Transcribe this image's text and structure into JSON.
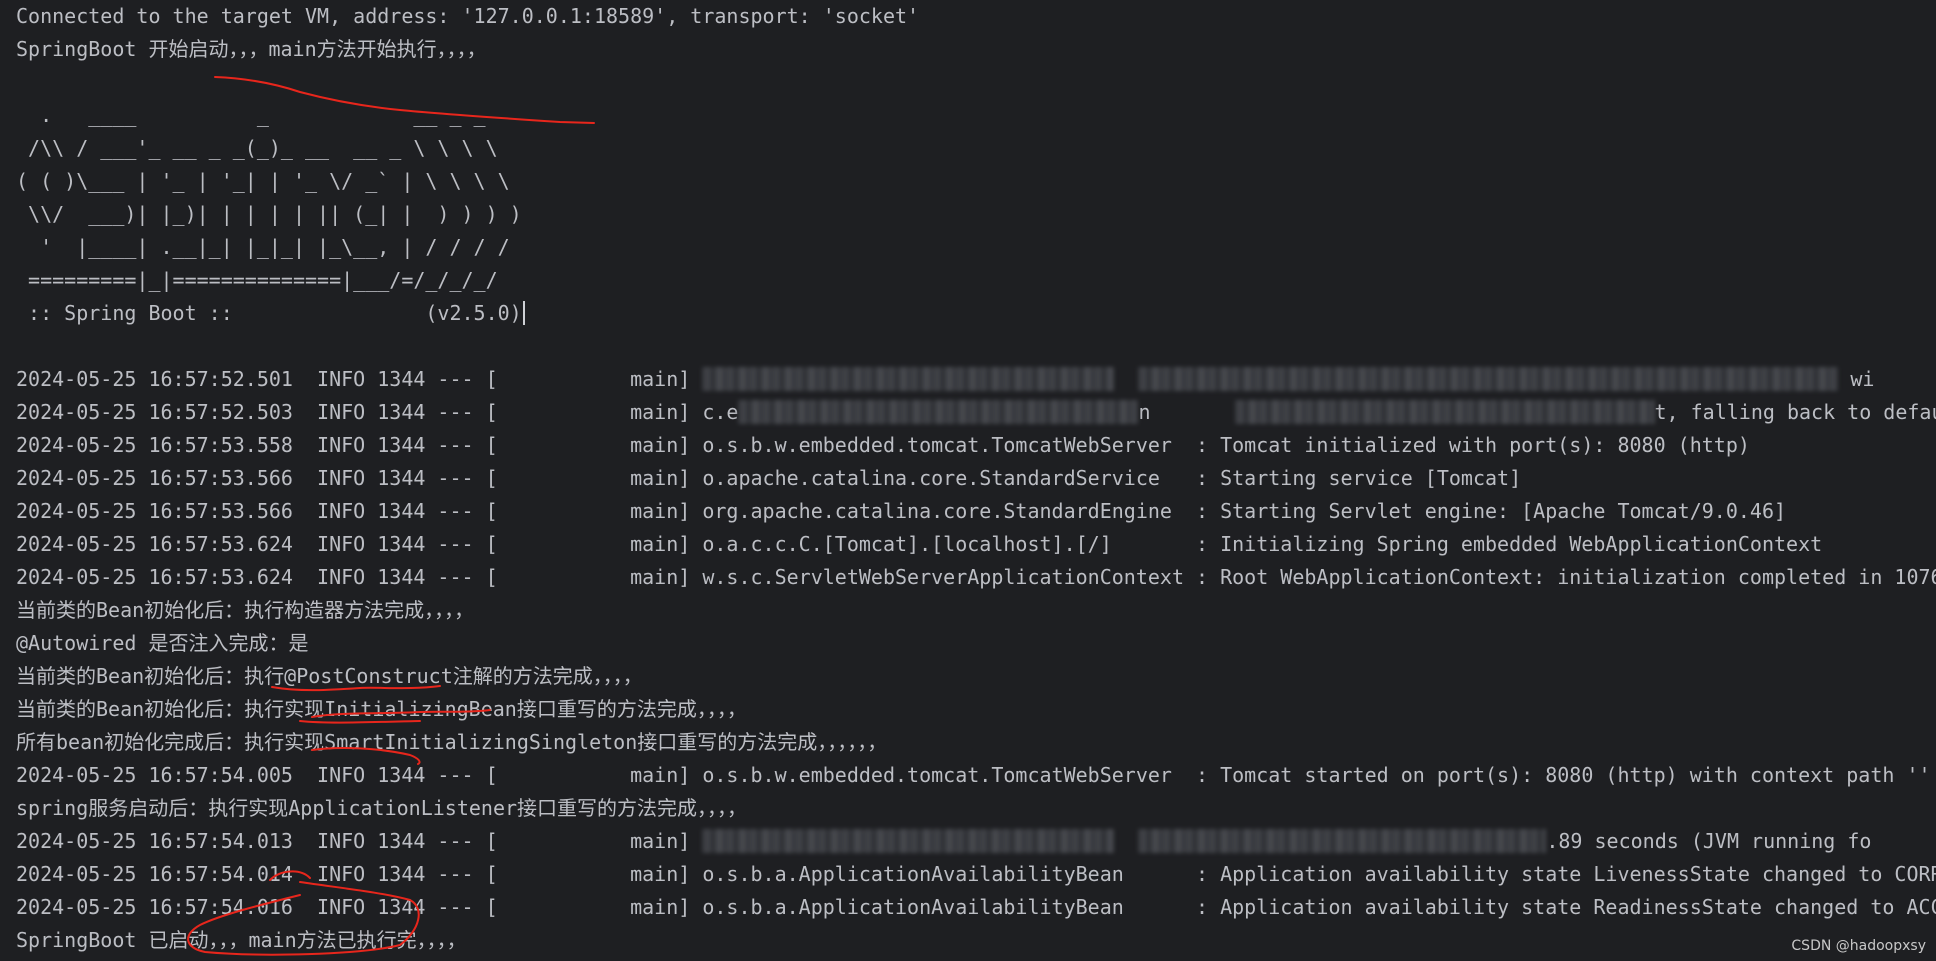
{
  "console": {
    "lines": [
      {
        "kind": "text",
        "text": "Connected to the target VM, address: '127.0.0.1:18589', transport: 'socket'"
      },
      {
        "kind": "text",
        "text": "SpringBoot 开始启动，，，main方法开始执行，，，，"
      },
      {
        "kind": "blank",
        "text": ""
      },
      {
        "kind": "banner",
        "text": "  .   ____          _            __ _ _"
      },
      {
        "kind": "banner",
        "text": " /\\\\ / ___'_ __ _ _(_)_ __  __ _ \\ \\ \\ \\"
      },
      {
        "kind": "banner",
        "text": "( ( )\\___ | '_ | '_| | '_ \\/ _` | \\ \\ \\ \\"
      },
      {
        "kind": "banner",
        "text": " \\\\/  ___)| |_)| | | | | || (_| |  ) ) ) )"
      },
      {
        "kind": "banner",
        "text": "  '  |____| .__|_| |_|_| |_\\__, | / / / /"
      },
      {
        "kind": "banner",
        "text": " =========|_|==============|___/=/_/_/_/"
      },
      {
        "kind": "banner-version",
        "text": " :: Spring Boot ::                (v2.5.0)"
      },
      {
        "kind": "blank",
        "text": ""
      },
      {
        "kind": "log-blurred",
        "prefix": "2024-05-25 16:57:52.501  INFO 1344 --- [           main] ",
        "tail": " wi"
      },
      {
        "kind": "log-blurred2",
        "prefix": "2024-05-25 16:57:52.503  INFO 1344 --- [           main] c.e",
        "mid": "n",
        "tail": "t, falling back to default p     s: def"
      },
      {
        "kind": "text",
        "text": "2024-05-25 16:57:53.558  INFO 1344 --- [           main] o.s.b.w.embedded.tomcat.TomcatWebServer  : Tomcat initialized with port(s): 8080 (http)"
      },
      {
        "kind": "text",
        "text": "2024-05-25 16:57:53.566  INFO 1344 --- [           main] o.apache.catalina.core.StandardService   : Starting service [Tomcat]"
      },
      {
        "kind": "text",
        "text": "2024-05-25 16:57:53.566  INFO 1344 --- [           main] org.apache.catalina.core.StandardEngine  : Starting Servlet engine: [Apache Tomcat/9.0.46]"
      },
      {
        "kind": "text",
        "text": "2024-05-25 16:57:53.624  INFO 1344 --- [           main] o.a.c.c.C.[Tomcat].[localhost].[/]       : Initializing Spring embedded WebApplicationContext"
      },
      {
        "kind": "text",
        "text": "2024-05-25 16:57:53.624  INFO 1344 --- [           main] w.s.c.ServletWebServerApplicationContext : Root WebApplicationContext: initialization completed in 1076"
      },
      {
        "kind": "text",
        "text": "当前类的Bean初始化后：执行构造器方法完成，，，，"
      },
      {
        "kind": "text",
        "text": "@Autowired 是否注入完成：是"
      },
      {
        "kind": "text",
        "text": "当前类的Bean初始化后：执行@PostConstruct注解的方法完成，，，，"
      },
      {
        "kind": "text",
        "text": "当前类的Bean初始化后：执行实现InitializingBean接口重写的方法完成，，，，"
      },
      {
        "kind": "text",
        "text": "所有bean初始化完成后：执行实现SmartInitializingSingleton接口重写的方法完成，，，，，，"
      },
      {
        "kind": "text",
        "text": "2024-05-25 16:57:54.005  INFO 1344 --- [           main] o.s.b.w.embedded.tomcat.TomcatWebServer  : Tomcat started on port(s): 8080 (http) with context path ''"
      },
      {
        "kind": "text",
        "text": "spring服务启动后：执行实现ApplicationListener接口重写的方法完成，，，，"
      },
      {
        "kind": "log-blurred3",
        "prefix": "2024-05-25 16:57:54.013  INFO 1344 --- [           main] ",
        "tail": ".89 seconds (JVM running fo"
      },
      {
        "kind": "text",
        "text": "2024-05-25 16:57:54.014  INFO 1344 --- [           main] o.s.b.a.ApplicationAvailabilityBean      : Application availability state LivenessState changed to CORR"
      },
      {
        "kind": "text",
        "text": "2024-05-25 16:57:54.016  INFO 1344 --- [           main] o.s.b.a.ApplicationAvailabilityBean      : Application availability state ReadinessState changed to ACC"
      },
      {
        "kind": "text",
        "text": "SpringBoot 已启动，，，main方法已执行完，，，，"
      }
    ]
  },
  "watermark": "CSDN @hadoopxsy",
  "colors": {
    "background": "#1e1f22",
    "text": "#bcbec4",
    "annotation": "#e8261c"
  }
}
